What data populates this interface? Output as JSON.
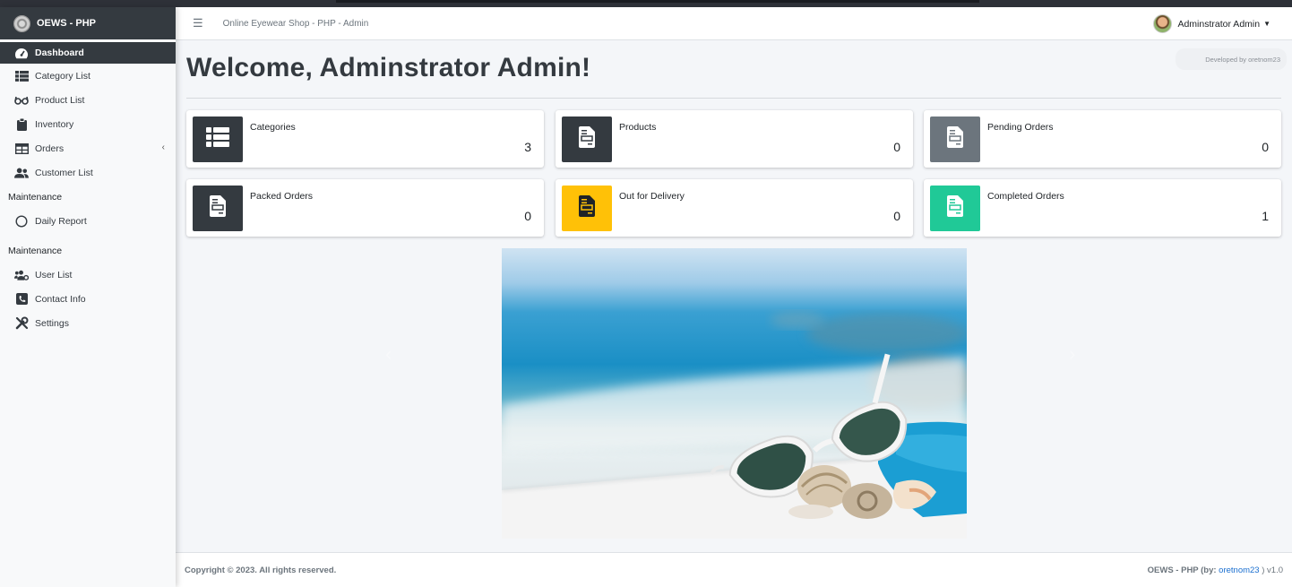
{
  "brand": {
    "name": "OEWS - PHP"
  },
  "navbar": {
    "site_title": "Online Eyewear Shop - PHP - Admin",
    "user_name": "Adminstrator Admin"
  },
  "sidebar": {
    "items": [
      {
        "label": "Dashboard",
        "icon": "tachometer-icon"
      },
      {
        "label": "Category List",
        "icon": "th-list-icon"
      },
      {
        "label": "Product List",
        "icon": "glasses-icon"
      },
      {
        "label": "Inventory",
        "icon": "clipboard-icon"
      },
      {
        "label": "Orders",
        "icon": "table-icon"
      },
      {
        "label": "Customer List",
        "icon": "users-icon"
      }
    ],
    "header1": "Maintenance",
    "maint1": [
      {
        "label": "Daily Report",
        "icon": "circle-icon"
      }
    ],
    "header2": "Maintenance",
    "maint2": [
      {
        "label": "User List",
        "icon": "users-cog-icon"
      },
      {
        "label": "Contact Info",
        "icon": "phone-square-icon"
      },
      {
        "label": "Settings",
        "icon": "tools-icon"
      }
    ]
  },
  "main": {
    "welcome": "Welcome, Adminstrator Admin!",
    "developed_by": "Developed by oretnom23",
    "cards": [
      {
        "label": "Categories",
        "value": "3",
        "color": "#343a40",
        "icon": "th-list-icon"
      },
      {
        "label": "Products",
        "value": "0",
        "color": "#343a40",
        "icon": "file-invoice-icon"
      },
      {
        "label": "Pending Orders",
        "value": "0",
        "color": "#6c757d",
        "icon": "file-invoice-icon"
      },
      {
        "label": "Packed Orders",
        "value": "0",
        "color": "#343a40",
        "icon": "file-invoice-icon"
      },
      {
        "label": "Out for Delivery",
        "value": "0",
        "color": "#ffc107",
        "icon": "file-invoice-icon"
      },
      {
        "label": "Completed Orders",
        "value": "1",
        "color": "#20c997",
        "icon": "file-invoice-icon"
      }
    ]
  },
  "footer": {
    "copyright": "Copyright © 2023. All rights reserved.",
    "credit_prefix": "OEWS - PHP (by: ",
    "credit_link": "oretnom23",
    "credit_suffix": " ) v1.0"
  }
}
